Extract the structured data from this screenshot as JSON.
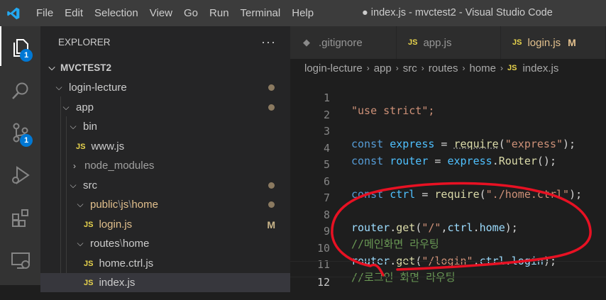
{
  "titlebar": {
    "menu": [
      "File",
      "Edit",
      "Selection",
      "View",
      "Go",
      "Run",
      "Terminal",
      "Help"
    ],
    "window_title": "● index.js - mvctest2 - Visual Studio Code"
  },
  "activity": {
    "explorer_badge": "1",
    "scm_badge": "1"
  },
  "explorer": {
    "header": "EXPLORER",
    "more": "···",
    "root": "MVCTEST2",
    "rows": [
      {
        "label": "login-lecture"
      },
      {
        "label": "app"
      },
      {
        "label": "bin"
      },
      {
        "label": "www.js",
        "icon": "JS"
      },
      {
        "label": "node_modules"
      },
      {
        "label": "src"
      },
      {
        "label_a": "public",
        "label_b": "js",
        "label_c": "home"
      },
      {
        "label": "login.js",
        "icon": "JS",
        "mark": "M"
      },
      {
        "label_a": "routes",
        "label_b": "home"
      },
      {
        "label": "home.ctrl.js",
        "icon": "JS"
      },
      {
        "label": "index.js",
        "icon": "JS"
      }
    ],
    "sep": "\\"
  },
  "tabs": [
    {
      "label": ".gitignore",
      "icon": "◆"
    },
    {
      "label": "app.js",
      "icon": "JS"
    },
    {
      "label": "login.js",
      "icon": "JS",
      "mark": "M"
    }
  ],
  "breadcrumb": {
    "parts": [
      "login-lecture",
      "app",
      "src",
      "routes",
      "home"
    ],
    "file_icon": "JS",
    "file": "index.js"
  },
  "code": {
    "line_numbers": [
      "1",
      "2",
      "3",
      "4",
      "5",
      "6",
      "7",
      "8",
      "9",
      "10",
      "11",
      "12"
    ],
    "l1": "\"use strict\";",
    "l3": {
      "kw": "const",
      "name": "express",
      "eq": " = ",
      "fn": "require",
      "open": "(",
      "str": "\"express\"",
      "close": ");"
    },
    "l4": {
      "kw": "const",
      "name": "router",
      "eq": " = ",
      "obj": "express",
      "dot": ".",
      "fn": "Router",
      "close": "();"
    },
    "l6": {
      "kw": "const",
      "name": "ctrl",
      "eq": " = ",
      "fn": "require",
      "open": "(",
      "str": "\"./home.ctrl\"",
      "close": ");"
    },
    "l8": {
      "obj": "router",
      "dot": ".",
      "fn": "get",
      "open": "(",
      "str": "\"/\"",
      "comma": ",",
      "arg": "ctrl",
      "dot2": ".",
      "prop": "home",
      "close": ");"
    },
    "l9": "//메인화면 라우팅",
    "l10": {
      "obj": "router",
      "dot": ".",
      "fn": "get",
      "open": "(",
      "str": "\"/login\"",
      "comma": ",",
      "arg": "ctrl",
      "dot2": ".",
      "prop": "login",
      "close": ");"
    },
    "l11": "//로그인 화면 라우팅"
  },
  "colors": {
    "annotation": "#e81123",
    "accent": "#0078d4",
    "modified": "#e2c08d"
  }
}
